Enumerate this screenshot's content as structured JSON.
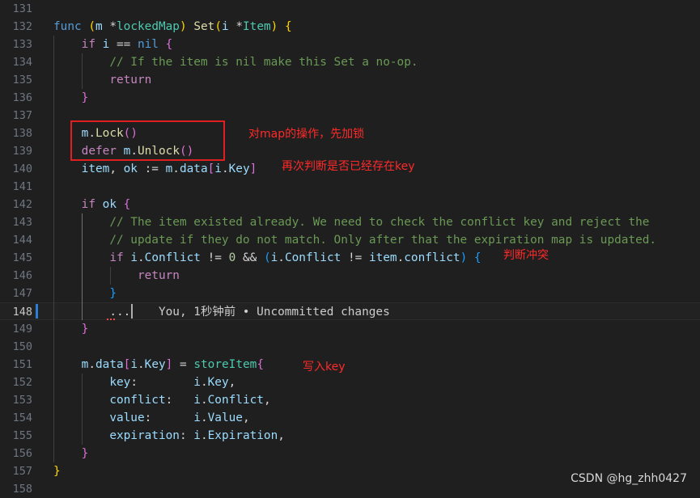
{
  "lines": [
    {
      "num": "131",
      "tokens": []
    },
    {
      "num": "132",
      "tokens": [
        [
          "kw",
          "func"
        ],
        [
          "op",
          " "
        ],
        [
          "br1",
          "("
        ],
        [
          "var",
          "m"
        ],
        [
          "op",
          " *"
        ],
        [
          "type",
          "lockedMap"
        ],
        [
          "br1",
          ")"
        ],
        [
          "op",
          " "
        ],
        [
          "fn",
          "Set"
        ],
        [
          "br1",
          "("
        ],
        [
          "var",
          "i"
        ],
        [
          "op",
          " *"
        ],
        [
          "type",
          "Item"
        ],
        [
          "br1",
          ")"
        ],
        [
          "op",
          " "
        ],
        [
          "br1",
          "{"
        ]
      ]
    },
    {
      "num": "133",
      "tokens": [
        [
          "op",
          "    "
        ],
        [
          "ctl",
          "if"
        ],
        [
          "op",
          " "
        ],
        [
          "var",
          "i"
        ],
        [
          "op",
          " == "
        ],
        [
          "kw",
          "nil"
        ],
        [
          "op",
          " "
        ],
        [
          "br2",
          "{"
        ]
      ]
    },
    {
      "num": "134",
      "tokens": [
        [
          "op",
          "        "
        ],
        [
          "cm",
          "// If the item is nil make this Set a no-op."
        ]
      ]
    },
    {
      "num": "135",
      "tokens": [
        [
          "op",
          "        "
        ],
        [
          "ctl",
          "return"
        ]
      ]
    },
    {
      "num": "136",
      "tokens": [
        [
          "op",
          "    "
        ],
        [
          "br2",
          "}"
        ]
      ]
    },
    {
      "num": "137",
      "tokens": []
    },
    {
      "num": "138",
      "tokens": [
        [
          "op",
          "    "
        ],
        [
          "var",
          "m"
        ],
        [
          "op",
          "."
        ],
        [
          "fn",
          "Lock"
        ],
        [
          "br2",
          "()"
        ]
      ]
    },
    {
      "num": "139",
      "tokens": [
        [
          "op",
          "    "
        ],
        [
          "ctl",
          "defer"
        ],
        [
          "op",
          " "
        ],
        [
          "var",
          "m"
        ],
        [
          "op",
          "."
        ],
        [
          "fn",
          "Unlock"
        ],
        [
          "br2",
          "()"
        ]
      ]
    },
    {
      "num": "140",
      "tokens": [
        [
          "op",
          "    "
        ],
        [
          "var",
          "item"
        ],
        [
          "op",
          ", "
        ],
        [
          "var",
          "ok"
        ],
        [
          "op",
          " := "
        ],
        [
          "var",
          "m"
        ],
        [
          "op",
          "."
        ],
        [
          "var",
          "data"
        ],
        [
          "br2",
          "["
        ],
        [
          "var",
          "i"
        ],
        [
          "op",
          "."
        ],
        [
          "var",
          "Key"
        ],
        [
          "br2",
          "]"
        ]
      ]
    },
    {
      "num": "141",
      "tokens": []
    },
    {
      "num": "142",
      "tokens": [
        [
          "op",
          "    "
        ],
        [
          "ctl",
          "if"
        ],
        [
          "op",
          " "
        ],
        [
          "var",
          "ok"
        ],
        [
          "op",
          " "
        ],
        [
          "br2",
          "{"
        ]
      ]
    },
    {
      "num": "143",
      "tokens": [
        [
          "op",
          "        "
        ],
        [
          "cm",
          "// The item existed already. We need to check the conflict key and reject the"
        ]
      ]
    },
    {
      "num": "144",
      "tokens": [
        [
          "op",
          "        "
        ],
        [
          "cm",
          "// update if they do not match. Only after that the expiration map is updated."
        ]
      ]
    },
    {
      "num": "145",
      "tokens": [
        [
          "op",
          "        "
        ],
        [
          "ctl",
          "if"
        ],
        [
          "op",
          " "
        ],
        [
          "var",
          "i"
        ],
        [
          "op",
          "."
        ],
        [
          "var",
          "Conflict"
        ],
        [
          "op",
          " != "
        ],
        [
          "num",
          "0"
        ],
        [
          "op",
          " && "
        ],
        [
          "br3",
          "("
        ],
        [
          "var",
          "i"
        ],
        [
          "op",
          "."
        ],
        [
          "var",
          "Conflict"
        ],
        [
          "op",
          " != "
        ],
        [
          "var",
          "item"
        ],
        [
          "op",
          "."
        ],
        [
          "var",
          "conflict"
        ],
        [
          "br3",
          ")"
        ],
        [
          "op",
          " "
        ],
        [
          "br3",
          "{"
        ]
      ]
    },
    {
      "num": "146",
      "tokens": [
        [
          "op",
          "            "
        ],
        [
          "ctl",
          "return"
        ]
      ]
    },
    {
      "num": "147",
      "tokens": [
        [
          "op",
          "        "
        ],
        [
          "br3",
          "}"
        ]
      ]
    },
    {
      "num": "148",
      "tokens": [
        [
          "op",
          "        "
        ],
        [
          "op",
          "..."
        ],
        [
          "op",
          "    "
        ],
        [
          "blame",
          "You, 1秒钟前 • Uncommitted changes"
        ]
      ]
    },
    {
      "num": "149",
      "tokens": [
        [
          "op",
          "    "
        ],
        [
          "br2",
          "}"
        ]
      ]
    },
    {
      "num": "150",
      "tokens": []
    },
    {
      "num": "151",
      "tokens": [
        [
          "op",
          "    "
        ],
        [
          "var",
          "m"
        ],
        [
          "op",
          "."
        ],
        [
          "var",
          "data"
        ],
        [
          "br2",
          "["
        ],
        [
          "var",
          "i"
        ],
        [
          "op",
          "."
        ],
        [
          "var",
          "Key"
        ],
        [
          "br2",
          "]"
        ],
        [
          "op",
          " = "
        ],
        [
          "type",
          "storeItem"
        ],
        [
          "br2",
          "{"
        ]
      ]
    },
    {
      "num": "152",
      "tokens": [
        [
          "op",
          "        "
        ],
        [
          "var",
          "key"
        ],
        [
          "op",
          ":        "
        ],
        [
          "var",
          "i"
        ],
        [
          "op",
          "."
        ],
        [
          "var",
          "Key"
        ],
        [
          "op",
          ","
        ]
      ]
    },
    {
      "num": "153",
      "tokens": [
        [
          "op",
          "        "
        ],
        [
          "var",
          "conflict"
        ],
        [
          "op",
          ":   "
        ],
        [
          "var",
          "i"
        ],
        [
          "op",
          "."
        ],
        [
          "var",
          "Conflict"
        ],
        [
          "op",
          ","
        ]
      ]
    },
    {
      "num": "154",
      "tokens": [
        [
          "op",
          "        "
        ],
        [
          "var",
          "value"
        ],
        [
          "op",
          ":      "
        ],
        [
          "var",
          "i"
        ],
        [
          "op",
          "."
        ],
        [
          "var",
          "Value"
        ],
        [
          "op",
          ","
        ]
      ]
    },
    {
      "num": "155",
      "tokens": [
        [
          "op",
          "        "
        ],
        [
          "var",
          "expiration"
        ],
        [
          "op",
          ": "
        ],
        [
          "var",
          "i"
        ],
        [
          "op",
          "."
        ],
        [
          "var",
          "Expiration"
        ],
        [
          "op",
          ","
        ]
      ]
    },
    {
      "num": "156",
      "tokens": [
        [
          "op",
          "    "
        ],
        [
          "br2",
          "}"
        ]
      ]
    },
    {
      "num": "157",
      "tokens": [
        [
          "br1",
          "}"
        ]
      ]
    },
    {
      "num": "158",
      "tokens": []
    }
  ],
  "annotations": {
    "lock": "对map的操作，先加锁",
    "check_key": "再次判断是否已经存在key",
    "conflict": "判断冲突",
    "write": "写入key"
  },
  "watermark": "CSDN @hg_zhh0427",
  "colors": {
    "background": "#1f1f1f",
    "annotation": "#ff2a2a",
    "keyword": "#569cd6",
    "control": "#c586c0",
    "function": "#dcdcaa",
    "variable": "#9cdcfe",
    "type": "#4ec9b0",
    "comment": "#6a9955"
  }
}
